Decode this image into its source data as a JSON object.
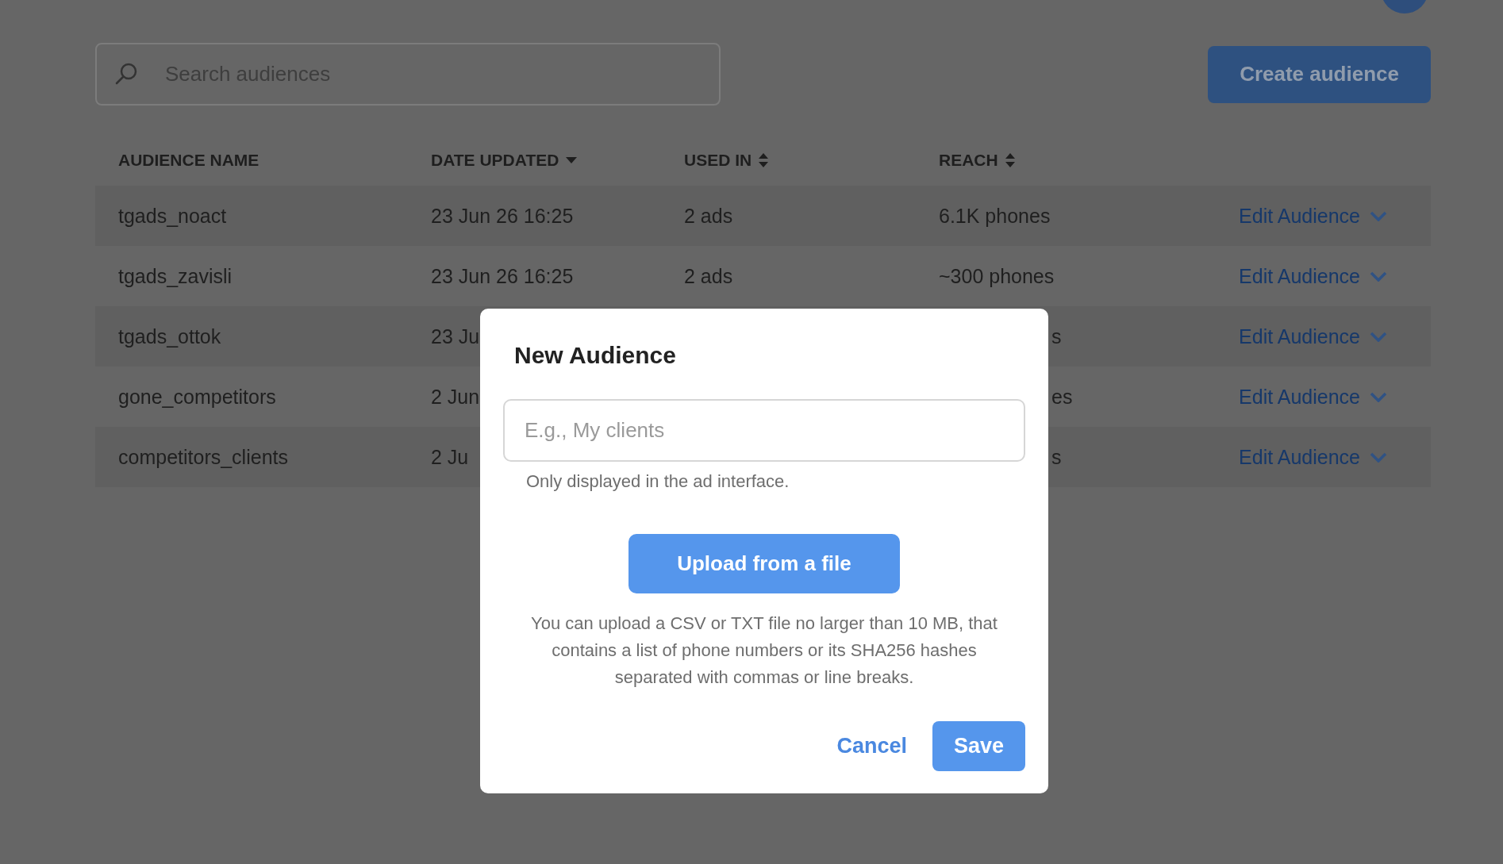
{
  "search": {
    "placeholder": "Search audiences"
  },
  "create_button": "Create audience",
  "table": {
    "columns": [
      {
        "label": "AUDIENCE NAME",
        "sortable": false
      },
      {
        "label": "DATE UPDATED",
        "sortable": true,
        "sorted": true
      },
      {
        "label": "USED IN",
        "sortable": true,
        "sorted": false
      },
      {
        "label": "REACH",
        "sortable": true,
        "sorted": false
      }
    ],
    "rows": [
      {
        "name": "tgads_noact",
        "date": "23 Jun 26 16:25",
        "used_in": "2 ads",
        "reach": "6.1K phones",
        "kind": "full",
        "action": "Edit Audience"
      },
      {
        "name": "tgads_zavisli",
        "date": "23 Jun 26 16:25",
        "used_in": "2 ads",
        "reach": "~300 phones",
        "kind": "full",
        "action": "Edit Audience"
      },
      {
        "name": "tgads_ottok",
        "date": "23 Ju",
        "reach": "s",
        "kind": "covered",
        "action": "Edit Audience"
      },
      {
        "name": "gone_competitors",
        "date": "2 Jun",
        "reach": "es",
        "kind": "covered",
        "action": "Edit Audience"
      },
      {
        "name": "competitors_clients",
        "date": "2 Ju",
        "reach": "s",
        "kind": "covered",
        "action": "Edit Audience"
      }
    ]
  },
  "dialog": {
    "title": "New Audience",
    "name_field": {
      "placeholder": "E.g., My clients"
    },
    "hint": "Only displayed in the ad interface.",
    "upload_button": "Upload from a file",
    "description": "You can upload a CSV or TXT file no larger than 10 MB, that contains a list of phone numbers or its SHA256 hashes separated with commas or line breaks.",
    "cancel_button": "Cancel",
    "save_button": "Save"
  }
}
